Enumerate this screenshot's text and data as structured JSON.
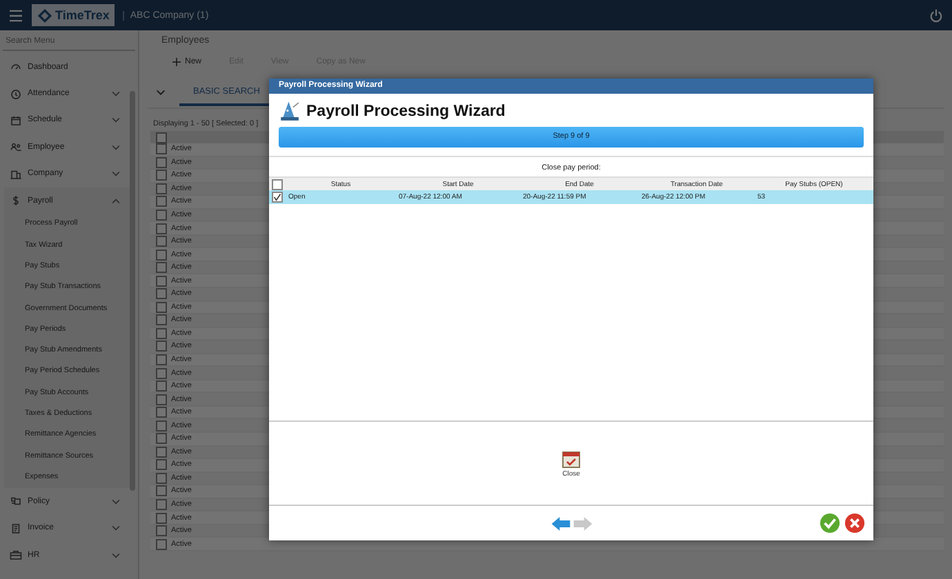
{
  "top_bar": {
    "logo_text": "TimeTrex",
    "company": "ABC Company (1)"
  },
  "sidebar": {
    "search_placeholder": "Search Menu",
    "items": [
      {
        "label": "Dashboard",
        "kind": "link"
      },
      {
        "label": "Attendance",
        "kind": "group",
        "expanded": false
      },
      {
        "label": "Schedule",
        "kind": "group",
        "expanded": false
      },
      {
        "label": "Employee",
        "kind": "group",
        "expanded": false
      },
      {
        "label": "Company",
        "kind": "group",
        "expanded": false
      },
      {
        "label": "Payroll",
        "kind": "group",
        "expanded": true,
        "children": [
          {
            "label": "Process Payroll"
          },
          {
            "label": "Tax Wizard"
          },
          {
            "label": "Pay Stubs"
          },
          {
            "label": "Pay Stub Transactions"
          },
          {
            "label": "Government Documents"
          },
          {
            "label": "Pay Periods"
          },
          {
            "label": "Pay Stub Amendments"
          },
          {
            "label": "Pay Period Schedules"
          },
          {
            "label": "Pay Stub Accounts"
          },
          {
            "label": "Taxes & Deductions"
          },
          {
            "label": "Remittance Agencies"
          },
          {
            "label": "Remittance Sources"
          },
          {
            "label": "Expenses"
          }
        ]
      },
      {
        "label": "Policy",
        "kind": "group",
        "expanded": false
      },
      {
        "label": "Invoice",
        "kind": "group",
        "expanded": false
      },
      {
        "label": "HR",
        "kind": "group",
        "expanded": false
      }
    ]
  },
  "main": {
    "title": "Employees",
    "toolbar": [
      {
        "label": "New",
        "disabled": false
      },
      {
        "label": "Edit",
        "disabled": true
      },
      {
        "label": "View",
        "disabled": true
      },
      {
        "label": "Copy as New",
        "disabled": true
      }
    ],
    "tabs": [
      {
        "label": "BASIC SEARCH",
        "selected": true
      }
    ],
    "summary": "Displaying 1 - 50 [ Selected: 0 ]",
    "header_checked": false,
    "rows": [
      {
        "status": "Active",
        "checked": false
      },
      {
        "status": "Active",
        "checked": false
      },
      {
        "status": "Active",
        "checked": false
      },
      {
        "status": "Active",
        "checked": false
      },
      {
        "status": "Active",
        "checked": false
      },
      {
        "status": "Active",
        "checked": false
      },
      {
        "status": "Active",
        "checked": false
      },
      {
        "status": "Active",
        "checked": false
      },
      {
        "status": "Active",
        "checked": false
      },
      {
        "status": "Active",
        "checked": false
      },
      {
        "status": "Active",
        "checked": false
      },
      {
        "status": "Active",
        "checked": false
      },
      {
        "status": "Active",
        "checked": false
      },
      {
        "status": "Active",
        "checked": false
      },
      {
        "status": "Active",
        "checked": false
      },
      {
        "status": "Active",
        "checked": false
      },
      {
        "status": "Active",
        "checked": false
      },
      {
        "status": "Active",
        "checked": false
      },
      {
        "status": "Active",
        "checked": false
      },
      {
        "status": "Active",
        "checked": false
      },
      {
        "status": "Active",
        "checked": false
      },
      {
        "status": "Active",
        "checked": false
      },
      {
        "status": "Active",
        "checked": false
      },
      {
        "status": "Active",
        "checked": false
      },
      {
        "status": "Active",
        "checked": false
      },
      {
        "status": "Active",
        "checked": false
      },
      {
        "status": "Active",
        "checked": false
      },
      {
        "status": "Active",
        "checked": false
      },
      {
        "status": "Active",
        "checked": false
      },
      {
        "status": "Active",
        "checked": false
      },
      {
        "status": "Active",
        "checked": false
      }
    ]
  },
  "wizard": {
    "window_title": "Payroll Processing Wizard",
    "heading": "Payroll Processing Wizard",
    "progress": {
      "label": "Step 9 of 9",
      "level": 1
    },
    "section_title": "Close pay period:",
    "table": {
      "all_checked": false,
      "columns": [
        "Status",
        "Start Date",
        "End Date",
        "Transaction Date",
        "Pay Stubs (OPEN)"
      ],
      "rows": [
        {
          "cells": [
            "Open",
            "07-Aug-22 12:00 AM",
            "20-Aug-22 11:59 PM",
            "26-Aug-22 12:00 PM",
            "53"
          ],
          "checked": true,
          "selected": true
        }
      ]
    },
    "action": {
      "label": "Close"
    },
    "nav": [
      {
        "kind": "back",
        "disabled": false
      },
      {
        "kind": "forward",
        "disabled": true
      }
    ],
    "buttons": [
      {
        "kind": "ok"
      },
      {
        "kind": "cancel"
      }
    ]
  }
}
